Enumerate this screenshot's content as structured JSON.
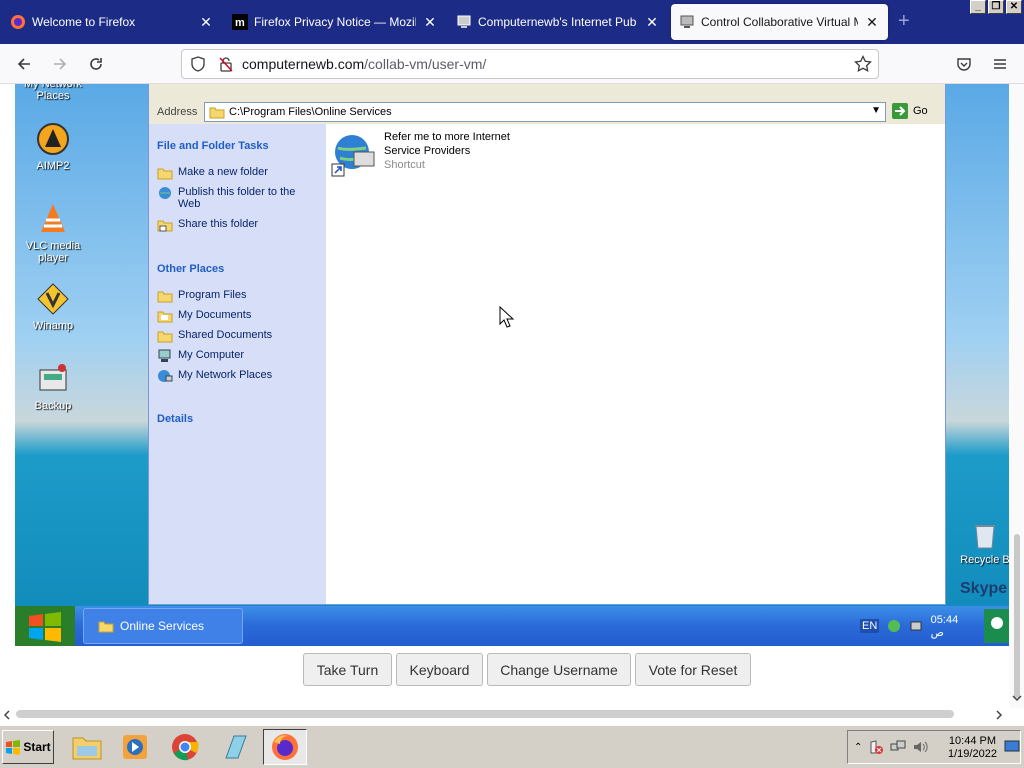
{
  "browser": {
    "tabs": [
      {
        "label": "Welcome to Firefox",
        "icon": "firefox-icon",
        "active": false
      },
      {
        "label": "Firefox Privacy Notice — Mozilla",
        "icon": "mozilla-m-icon",
        "active": false
      },
      {
        "label": "Computernewb's Internet Pub Hub",
        "icon": "computernewb-icon",
        "active": false
      },
      {
        "label": "Control Collaborative Virtual Machi",
        "icon": "computernewb-icon",
        "active": true
      }
    ],
    "url_host": "computernewb.com",
    "url_path": "/collab-vm/user-vm/"
  },
  "vm": {
    "desktop_icons": [
      {
        "label": "My Network Places",
        "icon": "network-places-icon"
      },
      {
        "label": "AIMP2",
        "icon": "aimp-icon"
      },
      {
        "label": "VLC media player",
        "icon": "vlc-icon"
      },
      {
        "label": "Winamp",
        "icon": "winamp-icon"
      },
      {
        "label": "Backup",
        "icon": "backup-icon"
      },
      {
        "label": "Recycle B",
        "icon": "recycle-bin-icon"
      }
    ],
    "skype_label": "Skype",
    "explorer": {
      "address_label": "Address",
      "address_value": "C:\\Program Files\\Online Services",
      "go_label": "Go",
      "file_tasks_title": "File and Folder Tasks",
      "file_tasks": [
        "Make a new folder",
        "Publish this folder to the Web",
        "Share this folder"
      ],
      "other_places_title": "Other Places",
      "other_places": [
        "Program Files",
        "My Documents",
        "Shared Documents",
        "My Computer",
        "My Network Places"
      ],
      "details_title": "Details",
      "shortcut_name": "Refer me to more Internet Service Providers",
      "shortcut_type": "Shortcut"
    },
    "taskbar": {
      "task_label": "Online Services",
      "lang": "EN",
      "clock": "05:44 ص"
    }
  },
  "controls": {
    "take_turn": "Take Turn",
    "keyboard": "Keyboard",
    "change_username": "Change Username",
    "vote_reset": "Vote for Reset"
  },
  "host": {
    "start_label": "Start",
    "apps": [
      "file-explorer-icon",
      "media-player-icon",
      "chrome-icon",
      "notepad-icon",
      "firefox-icon"
    ],
    "time": "10:44 PM",
    "date": "1/19/2022"
  }
}
